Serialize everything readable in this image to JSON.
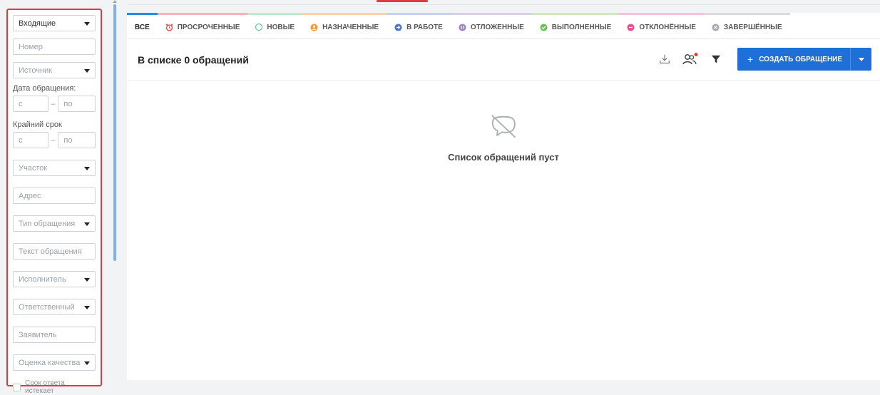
{
  "filters": {
    "direction": "Входящие",
    "number_placeholder": "Номер",
    "source_placeholder": "Источник",
    "date_label": "Дата обращения:",
    "date_from": "с",
    "date_to": "по",
    "deadline_label": "Крайний срок",
    "deadline_from": "с",
    "deadline_to": "по",
    "area_placeholder": "Участок",
    "address_placeholder": "Адрес",
    "type_placeholder": "Тип обращения",
    "text_placeholder": "Текст обращения",
    "executor_placeholder": "Исполнитель",
    "responsible_placeholder": "Ответственный",
    "applicant_placeholder": "Заявитель",
    "quality_placeholder": "Оценка качества",
    "expiring_label": "Срок ответа истекает"
  },
  "tabs": {
    "all": "ВСЕ",
    "overdue": "ПРОСРОЧЕННЫЕ",
    "new": "НОВЫЕ",
    "assigned": "НАЗНАЧЕННЫЕ",
    "inwork": "В РАБОТЕ",
    "postponed": "ОТЛОЖЕННЫЕ",
    "done": "ВЫПОЛНЕННЫЕ",
    "rejected": "ОТКЛОНЁННЫЕ",
    "finished": "ЗАВЕРШЁННЫЕ"
  },
  "header": {
    "count_text": "В списке 0 обращений",
    "create_label": "СОЗДАТЬ ОБРАЩЕНИЕ"
  },
  "empty": {
    "text": "Список обращений пуст"
  },
  "colors": {
    "accent": "#1f6fd8",
    "filter_border": "#e0393e"
  }
}
